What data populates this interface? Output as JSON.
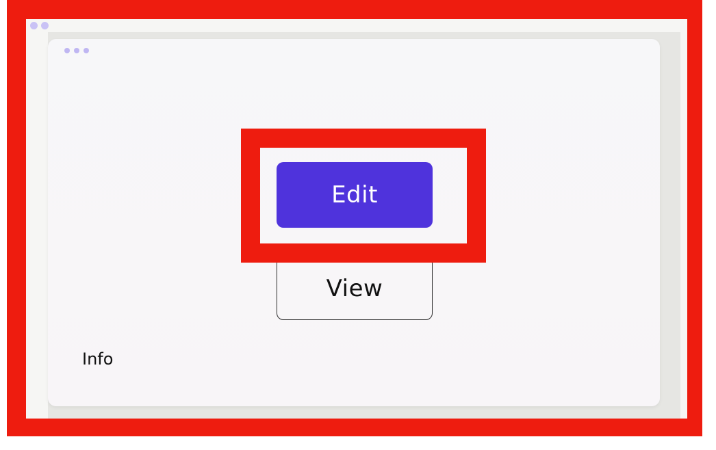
{
  "colors": {
    "highlight": "#ee1c0f",
    "primary": "#4f33dc",
    "card_background": "#f8f7fa",
    "dot_accent": "#c9c2f5"
  },
  "window_dots_icon": "more-horizontal-icon",
  "card": {
    "menu_icon": "more-horizontal-icon",
    "buttons": {
      "edit_label": "Edit",
      "view_label": "View"
    },
    "info_label": "Info"
  }
}
